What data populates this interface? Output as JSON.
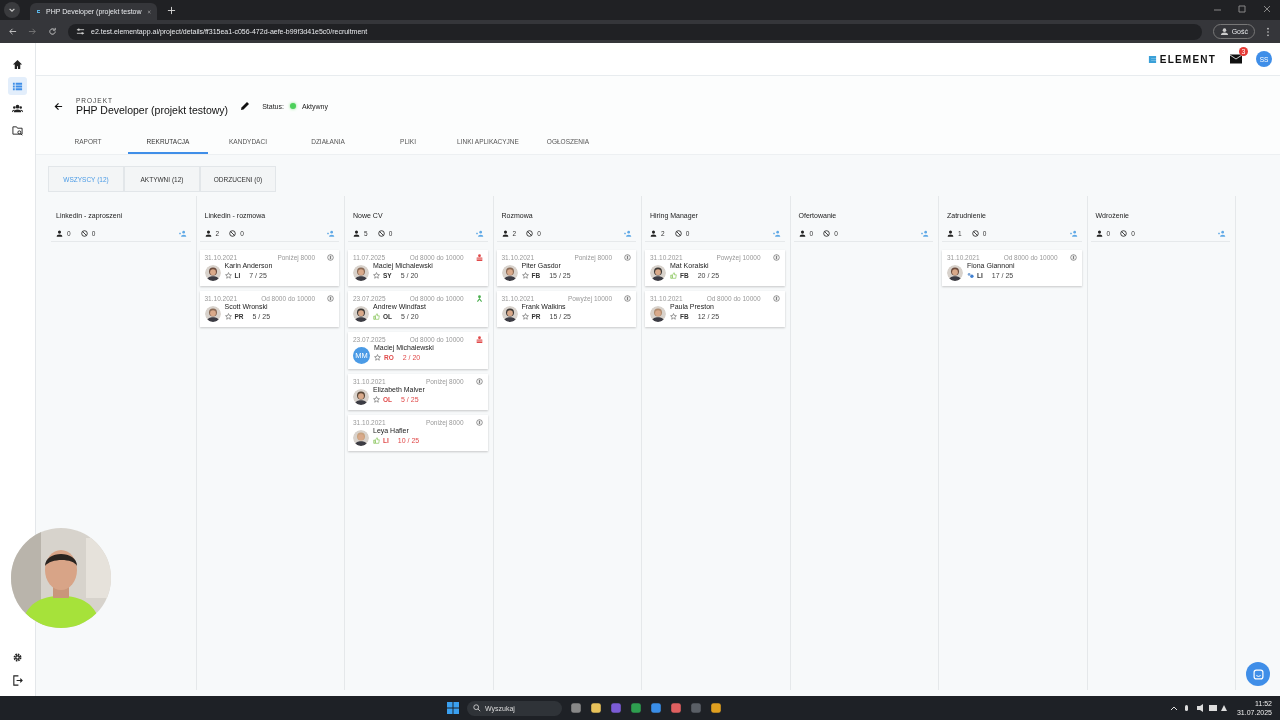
{
  "browser": {
    "tab_title": "PHP Developer (projekt testow",
    "url": "e2.test.elementapp.ai/project/details/ff315ea1-c056-472d-aefe-b99f3d41e5c0/recruitment",
    "profile": "Gość"
  },
  "sidebar": {
    "items": [
      {
        "kind": "home",
        "selected": false
      },
      {
        "kind": "list",
        "selected": true
      },
      {
        "kind": "people",
        "selected": false
      },
      {
        "kind": "folder-search",
        "selected": false
      }
    ]
  },
  "header": {
    "logo": "ELEMENT",
    "mail_badge": "3",
    "avatar": "SS"
  },
  "project": {
    "label": "PROJEKT",
    "title": "PHP Developer (projekt testowy)",
    "status_label": "Status:",
    "status": "Aktywny"
  },
  "tabs": [
    {
      "label": "RAPORT",
      "selected": false
    },
    {
      "label": "REKRUTACJA",
      "selected": true
    },
    {
      "label": "KANDYDACI",
      "selected": false
    },
    {
      "label": "DZIAŁANIA",
      "selected": false
    },
    {
      "label": "PLIKI",
      "selected": false
    },
    {
      "label": "LINKI APLIKACYJNE",
      "selected": false
    },
    {
      "label": "OGŁOSZENIA",
      "selected": false
    }
  ],
  "filters": [
    {
      "label": "WSZYSCY (12)",
      "selected": true
    },
    {
      "label": "AKTYWNI (12)",
      "selected": false
    },
    {
      "label": "ODRZUCENI (0)",
      "selected": false
    }
  ],
  "columns": [
    {
      "title": "Linkedin - zaproszeni",
      "candidates": "0",
      "rejected": "0"
    },
    {
      "title": "Linkedin - rozmowa",
      "candidates": "2",
      "rejected": "0",
      "cards": [
        {
          "date": "31.10.2021",
          "salary": "Poniżej 8000",
          "status_icon": {
            "kind": "salary"
          },
          "name": "Karin Anderson",
          "reaction_icon": {
            "kind": "star"
          },
          "source": "LI",
          "score": "7 / 25",
          "warn": false
        },
        {
          "date": "31.10.2021",
          "salary": "Od 8000 do 10000",
          "status_icon": {
            "kind": "salary"
          },
          "name": "Scott Wronski",
          "reaction_icon": {
            "kind": "star"
          },
          "source": "PR",
          "score": "5 / 25",
          "warn": false
        }
      ]
    },
    {
      "title": "Nowe CV",
      "candidates": "5",
      "rejected": "0",
      "cards": [
        {
          "date": "11.07.2025",
          "salary": "Od 8000 do 10000",
          "status_icon": {
            "kind": "alert"
          },
          "name": "Maciej Michalewski",
          "reaction_icon": {
            "kind": "star"
          },
          "source": "SY",
          "score": "5 / 20",
          "warn": false
        },
        {
          "date": "23.07.2025",
          "salary": "Od 8000 do 10000",
          "status_icon": {
            "kind": "ok"
          },
          "name": "Andrew Windfast",
          "reaction_icon": {
            "kind": "thumb"
          },
          "source": "OL",
          "score": "5 / 20",
          "warn": false
        },
        {
          "date": "23.07.2025",
          "salary": "Od 8000 do 10000",
          "status_icon": {
            "kind": "alert"
          },
          "avatar": {
            "kind": "initials",
            "text": "MM"
          },
          "name": "Maciej Michalewski",
          "reaction_icon": {
            "kind": "star"
          },
          "source": "RO",
          "score": "2 / 20",
          "warn": true
        },
        {
          "date": "31.10.2021",
          "salary": "Poniżej 8000",
          "status_icon": {
            "kind": "salary"
          },
          "name": "Elizabeth Malver",
          "reaction_icon": {
            "kind": "star"
          },
          "source": "OL",
          "score": "5 / 25",
          "warn": true
        },
        {
          "date": "31.10.2021",
          "salary": "Poniżej 8000",
          "status_icon": {
            "kind": "salary"
          },
          "name": "Leya Hafler",
          "reaction_icon": {
            "kind": "thumb"
          },
          "source": "LI",
          "score": "10 / 25",
          "warn": true
        }
      ]
    },
    {
      "title": "Rozmowa",
      "candidates": "2",
      "rejected": "0",
      "cards": [
        {
          "date": "31.10.2021",
          "salary": "Poniżej 8000",
          "status_icon": {
            "kind": "salary"
          },
          "name": "Piter Gasdor",
          "reaction_icon": {
            "kind": "star"
          },
          "source": "FB",
          "score": "15 / 25",
          "warn": false
        },
        {
          "date": "31.10.2021",
          "salary": "Powyżej 10000",
          "status_icon": {
            "kind": "salary"
          },
          "name": "Frank Walkins",
          "reaction_icon": {
            "kind": "star"
          },
          "source": "PR",
          "score": "15 / 25",
          "warn": false
        }
      ]
    },
    {
      "title": "Hiring Manager",
      "candidates": "2",
      "rejected": "0",
      "cards": [
        {
          "date": "31.10.2021",
          "salary": "Powyżej 10000",
          "status_icon": {
            "kind": "salary"
          },
          "name": "Mat Koralski",
          "reaction_icon": {
            "kind": "thumb"
          },
          "source": "FB",
          "score": "20 / 25",
          "warn": false
        },
        {
          "date": "31.10.2021",
          "salary": "Od 8000 do 10000",
          "status_icon": {
            "kind": "salary"
          },
          "name": "Paula Preston",
          "reaction_icon": {
            "kind": "star"
          },
          "source": "FB",
          "score": "12 / 25",
          "warn": false
        }
      ]
    },
    {
      "title": "Ofertowanie",
      "candidates": "0",
      "rejected": "0"
    },
    {
      "title": "Zatrudnienie",
      "candidates": "1",
      "rejected": "0",
      "cards": [
        {
          "date": "31.10.2021",
          "salary": "Od 8000 do 10000",
          "status_icon": {
            "kind": "salary"
          },
          "name": "Fiona Giannoni",
          "reaction_icon": {
            "kind": "pair"
          },
          "source": "LI",
          "score": "17 / 25",
          "warn": false
        }
      ]
    },
    {
      "title": "Wdrożenie",
      "candidates": "0",
      "rejected": "0"
    }
  ],
  "taskbar": {
    "search": "Wyszukaj",
    "time": "11:52",
    "date": "31.07.2025"
  }
}
